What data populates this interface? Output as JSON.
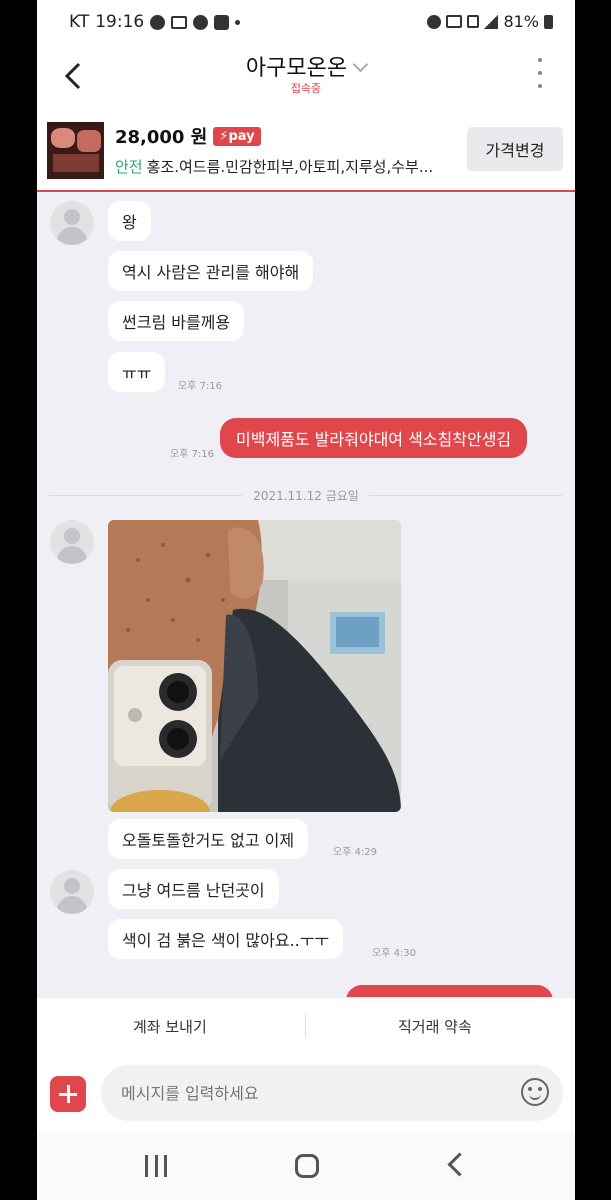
{
  "status_bar": {
    "carrier": "KT",
    "time": "19:16",
    "battery": "81%"
  },
  "header": {
    "title": "아구모온온",
    "subtitle": "접속중"
  },
  "product": {
    "price": "28,000 원",
    "pay_badge": "pay",
    "safe_label": "안전",
    "description": "홍조.여드름.민감한피부,아토피,지루성,수부...",
    "price_change_button": "가격변경"
  },
  "messages": {
    "m1": "왕",
    "m2": "역시 사람은 관리를 해야해",
    "m3": "썬크림 바를께용",
    "m4": "ㅠㅠ",
    "t1": "오후 7:16",
    "m5": "미백제품도 발라줘야대여 색소침착안생김",
    "t2": "오후 7:16",
    "date_separator": "2021.11.12 금요일",
    "m6": "오돌토돌한거도 없고 이제",
    "t3": "오후 4:29",
    "m7": "그냥 여드름 난던곳이",
    "m8": "색이 검 붉은 색이 많아요..ㅜㅜ",
    "t4": "오후 4:30"
  },
  "quick_actions": {
    "send_account": "계좌 보내기",
    "direct_deal": "직거래 약속"
  },
  "input": {
    "placeholder": "메시지를 입력하세요"
  },
  "colors": {
    "accent": "#e0474c",
    "safe_green": "#2aa67a",
    "chat_bg": "#f0eff5"
  }
}
